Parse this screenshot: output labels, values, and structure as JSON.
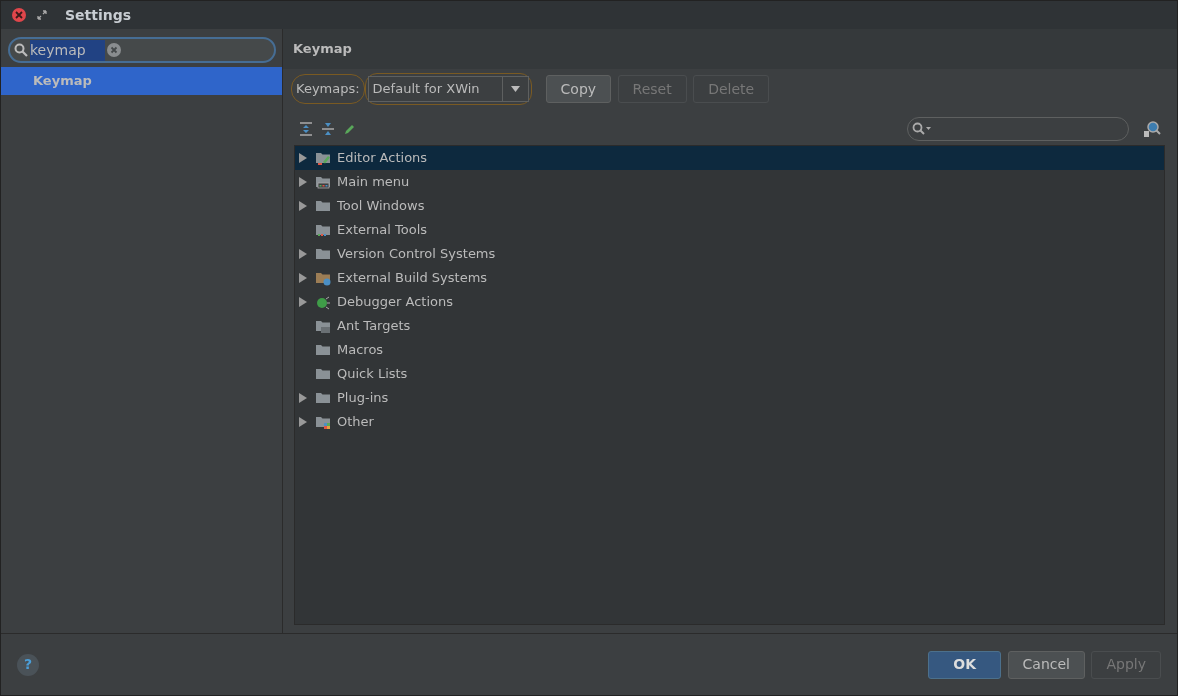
{
  "window": {
    "title": "Settings"
  },
  "sidebar": {
    "search": {
      "value": "keymap"
    },
    "items": [
      {
        "label": "Keymap",
        "selected": true
      }
    ]
  },
  "page": {
    "title": "Keymap",
    "keymaps_label": "Keymaps:",
    "keymap_value": "Default for XWin",
    "buttons": [
      {
        "label": "Copy",
        "disabled": false
      },
      {
        "label": "Reset",
        "disabled": true
      },
      {
        "label": "Delete",
        "disabled": true
      }
    ],
    "tree": [
      {
        "label": "Editor Actions",
        "expandable": true,
        "selected": true,
        "kind": "editor"
      },
      {
        "label": "Main menu",
        "expandable": true,
        "selected": false,
        "kind": "menu"
      },
      {
        "label": "Tool Windows",
        "expandable": true,
        "selected": false,
        "kind": "folder"
      },
      {
        "label": "External Tools",
        "expandable": false,
        "selected": false,
        "kind": "tools"
      },
      {
        "label": "Version Control Systems",
        "expandable": true,
        "selected": false,
        "kind": "folder"
      },
      {
        "label": "External Build Systems",
        "expandable": true,
        "selected": false,
        "kind": "build"
      },
      {
        "label": "Debugger Actions",
        "expandable": true,
        "selected": false,
        "kind": "bug"
      },
      {
        "label": "Ant Targets",
        "expandable": false,
        "selected": false,
        "kind": "ant"
      },
      {
        "label": "Macros",
        "expandable": false,
        "selected": false,
        "kind": "folder"
      },
      {
        "label": "Quick Lists",
        "expandable": false,
        "selected": false,
        "kind": "folder"
      },
      {
        "label": "Plug-ins",
        "expandable": true,
        "selected": false,
        "kind": "folder"
      },
      {
        "label": "Other",
        "expandable": true,
        "selected": false,
        "kind": "other"
      }
    ]
  },
  "footer": {
    "help": "?",
    "buttons": [
      {
        "label": "OK",
        "kind": "default",
        "disabled": false
      },
      {
        "label": "Cancel",
        "kind": "normal",
        "disabled": false
      },
      {
        "label": "Apply",
        "kind": "normal",
        "disabled": true
      }
    ]
  }
}
